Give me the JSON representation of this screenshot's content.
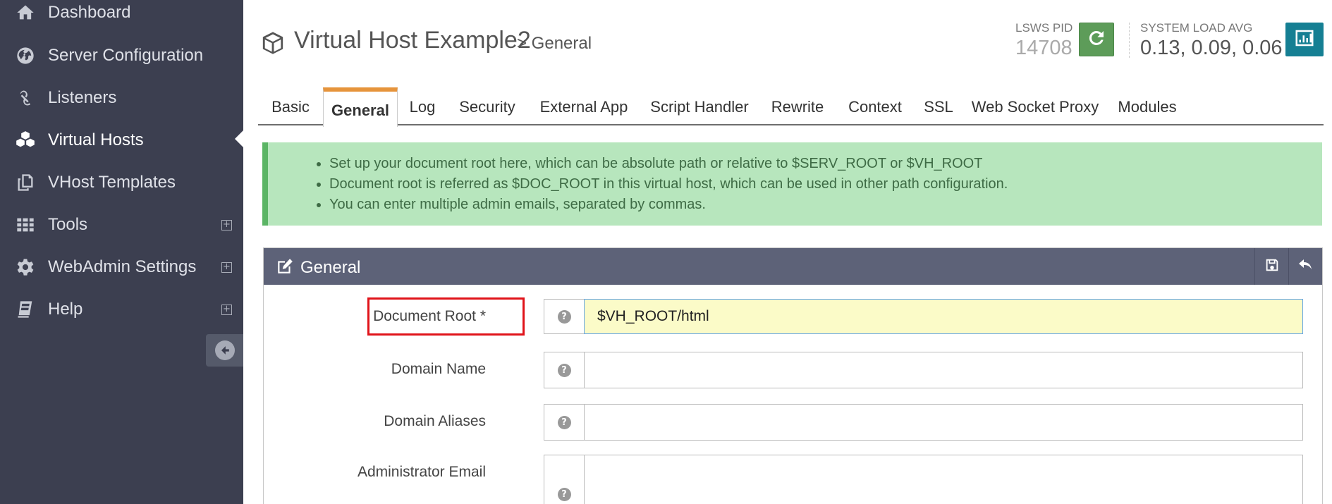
{
  "sidebar": {
    "items": [
      {
        "label": "Dashboard",
        "icon": "home-icon",
        "expandable": false
      },
      {
        "label": "Server Configuration",
        "icon": "globe-icon",
        "expandable": false
      },
      {
        "label": "Listeners",
        "icon": "link-icon",
        "expandable": false
      },
      {
        "label": "Virtual Hosts",
        "icon": "cubes-icon",
        "expandable": false,
        "active": true
      },
      {
        "label": "VHost Templates",
        "icon": "copy-icon",
        "expandable": false
      },
      {
        "label": "Tools",
        "icon": "grid-icon",
        "expandable": true
      },
      {
        "label": "WebAdmin Settings",
        "icon": "gear-icon",
        "expandable": true
      },
      {
        "label": "Help",
        "icon": "book-icon",
        "expandable": true
      }
    ],
    "expand_symbol": "+"
  },
  "header": {
    "title": "Virtual Host Example2",
    "subtitle": "> General",
    "pid_label": "LSWS PID",
    "pid_value": "14708",
    "load_label": "SYSTEM LOAD AVG",
    "load_value": "0.13, 0.09, 0.06"
  },
  "tabs": [
    {
      "label": "Basic"
    },
    {
      "label": "General",
      "active": true
    },
    {
      "label": "Log"
    },
    {
      "label": "Security"
    },
    {
      "label": "External App"
    },
    {
      "label": "Script Handler"
    },
    {
      "label": "Rewrite"
    },
    {
      "label": "Context"
    },
    {
      "label": "SSL"
    },
    {
      "label": "Web Socket Proxy"
    },
    {
      "label": "Modules"
    }
  ],
  "info": [
    "Set up your document root here, which can be absolute path or relative to $SERV_ROOT or $VH_ROOT",
    "Document root is referred as $DOC_ROOT in this virtual host, which can be used in other path configuration.",
    "You can enter multiple admin emails, separated by commas."
  ],
  "panel": {
    "title": "General",
    "help_symbol": "?",
    "fields": [
      {
        "label": "Document Root *",
        "value": "$VH_ROOT/html"
      },
      {
        "label": "Domain Name",
        "value": ""
      },
      {
        "label": "Domain Aliases",
        "value": ""
      },
      {
        "label": "Administrator Email",
        "value": ""
      }
    ]
  },
  "colors": {
    "sidebar_bg": "#3c3f50",
    "panel_header_bg": "#5d6278",
    "active_tab_accent": "#e6943b",
    "alert_bg": "#b7e6bd",
    "restart_button": "#5d9c59",
    "stats_button": "#157f93",
    "highlight": "#e0131a"
  }
}
